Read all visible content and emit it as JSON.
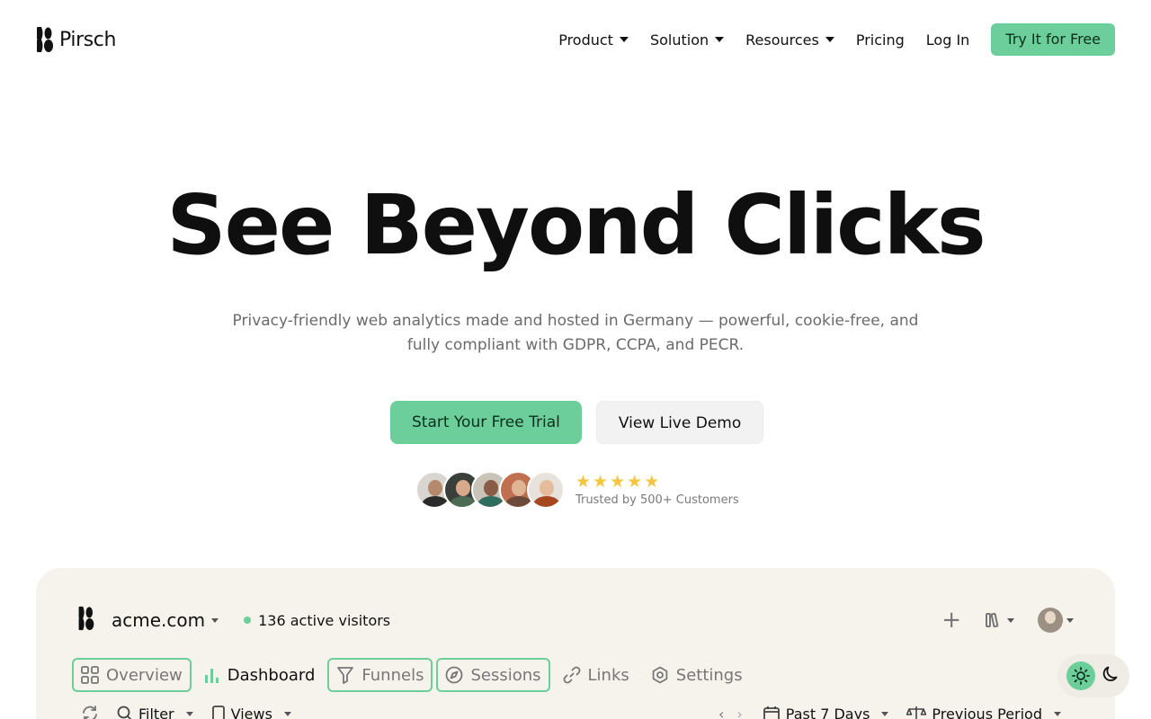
{
  "brand": {
    "name": "Pirsch",
    "logo_icon": "pirsch-logo-icon",
    "accent": "#6cce9a"
  },
  "nav": {
    "items": [
      {
        "label": "Product",
        "dropdown": true
      },
      {
        "label": "Solution",
        "dropdown": true
      },
      {
        "label": "Resources",
        "dropdown": true
      },
      {
        "label": "Pricing",
        "dropdown": false
      },
      {
        "label": "Log In",
        "dropdown": false
      }
    ],
    "cta": "Try It for Free"
  },
  "hero": {
    "title": "See Beyond Clicks",
    "subtitle": "Privacy-friendly web analytics made and hosted in Germany — powerful, cookie-free, and fully compliant with GDPR, CCPA, and PECR.",
    "primary_cta": "Start Your Free Trial",
    "secondary_cta": "View Live Demo"
  },
  "social_proof": {
    "rating": 5,
    "stars": [
      "★",
      "★",
      "★",
      "★",
      "★"
    ],
    "trusted_text": "Trusted by 500+ Customers",
    "avatar_colors": [
      {
        "bg": "#d9d6d2",
        "face": "#b58a6c",
        "body": "#2b2b2b"
      },
      {
        "bg": "#3a3f3a",
        "face": "#d8a98a",
        "body": "#4d6b54"
      },
      {
        "bg": "#c9c3b8",
        "face": "#8a5b45",
        "body": "#2f6e5f"
      },
      {
        "bg": "#c0704e",
        "face": "#e0b596",
        "body": "#6b4a3a"
      },
      {
        "bg": "#e7e2db",
        "face": "#e6bd9c",
        "body": "#a5471f"
      }
    ]
  },
  "dashboard": {
    "site": "acme.com",
    "active_visitors": "136 active visitors",
    "tabs": [
      {
        "label": "Overview",
        "icon": "grid-icon",
        "boxed": true,
        "active": false
      },
      {
        "label": "Dashboard",
        "icon": "bar-chart-icon",
        "boxed": false,
        "active": true
      },
      {
        "label": "Funnels",
        "icon": "funnel-icon",
        "boxed": true,
        "active": false
      },
      {
        "label": "Sessions",
        "icon": "compass-icon",
        "boxed": true,
        "active": false
      },
      {
        "label": "Links",
        "icon": "link-icon",
        "boxed": false,
        "active": false
      },
      {
        "label": "Settings",
        "icon": "gear-icon",
        "boxed": false,
        "active": false
      }
    ],
    "toolbar": {
      "filter": "Filter",
      "views": "Views",
      "date_range": "Past 7 Days",
      "compare": "Previous Period"
    }
  }
}
